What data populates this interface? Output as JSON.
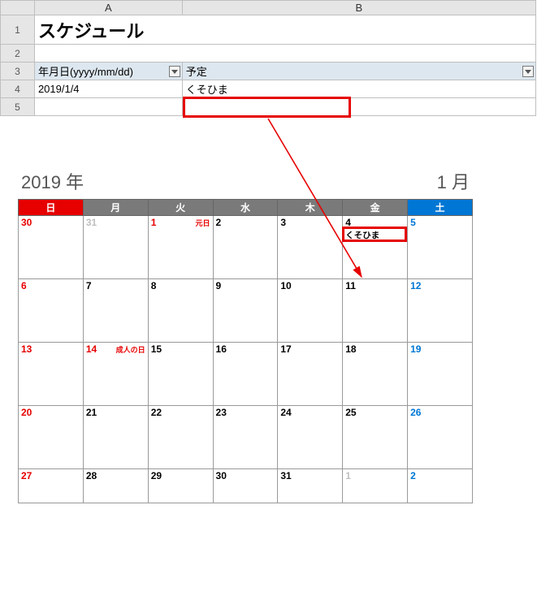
{
  "spreadsheet": {
    "cols": {
      "A": "A",
      "B": "B"
    },
    "rows": {
      "r1": "1",
      "r2": "2",
      "r3": "3",
      "r4": "4",
      "r5": "5"
    },
    "title": "スケジュール",
    "header_date": "年月日(yyyy/mm/dd)",
    "header_event": "予定",
    "data_date": "2019/1/4",
    "data_event": "くそひま"
  },
  "calendar": {
    "year_label": "2019 年",
    "month_label": "1 月",
    "dow": {
      "sun": "日",
      "mon": "月",
      "tue": "火",
      "wed": "水",
      "thu": "木",
      "fri": "金",
      "sat": "土"
    },
    "holidays": {
      "jan1": "元日",
      "jan14": "成人の日"
    },
    "event_text": "くそひま",
    "days": {
      "p30": "30",
      "p31": "31",
      "d1": "1",
      "d2": "2",
      "d3": "3",
      "d4": "4",
      "d5": "5",
      "d6": "6",
      "d7": "7",
      "d8": "8",
      "d9": "9",
      "d10": "10",
      "d11": "11",
      "d12": "12",
      "d13": "13",
      "d14": "14",
      "d15": "15",
      "d16": "16",
      "d17": "17",
      "d18": "18",
      "d19": "19",
      "d20": "20",
      "d21": "21",
      "d22": "22",
      "d23": "23",
      "d24": "24",
      "d25": "25",
      "d26": "26",
      "d27": "27",
      "d28": "28",
      "d29": "29",
      "d30": "30",
      "d31": "31",
      "n1": "1",
      "n2": "2"
    }
  }
}
